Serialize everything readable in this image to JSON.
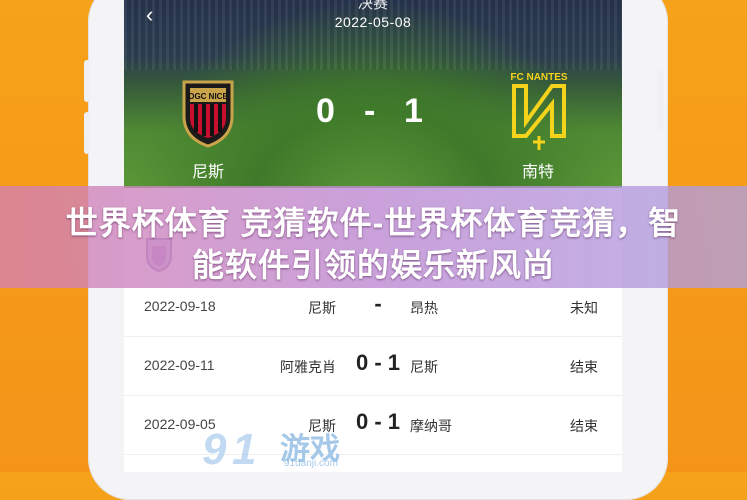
{
  "header": {
    "title_partial": "决赛",
    "date": "2022-05-08",
    "back_icon": "chevron-left-icon"
  },
  "match": {
    "home_team": "尼斯",
    "away_team": "南特",
    "home_score": "0",
    "separator": "-",
    "away_score": "1",
    "away_crest_text": "FC NANTES",
    "home_crest_text": "OGC NICE"
  },
  "banner": {
    "line1": "世界杯体育 竞猜软件-世界杯体育竞猜，智",
    "line2": "能软件引领的娱乐新风尚"
  },
  "fixtures": [
    {
      "date": "2022-09-18",
      "home": "尼斯",
      "score": "-",
      "away": "昂热",
      "status": "未知"
    },
    {
      "date": "2022-09-11",
      "home": "阿雅克肖",
      "score": "0 - 1",
      "away": "尼斯",
      "status": "结束"
    },
    {
      "date": "2022-09-05",
      "home": "尼斯",
      "score": "0 - 1",
      "away": "摩纳哥",
      "status": "结束"
    }
  ],
  "watermark": {
    "brand": "游戏",
    "url": "91danji.com"
  },
  "colors": {
    "background": "#f59a18",
    "nantes_yellow": "#f5d21b",
    "nice_red": "#c8102e"
  }
}
